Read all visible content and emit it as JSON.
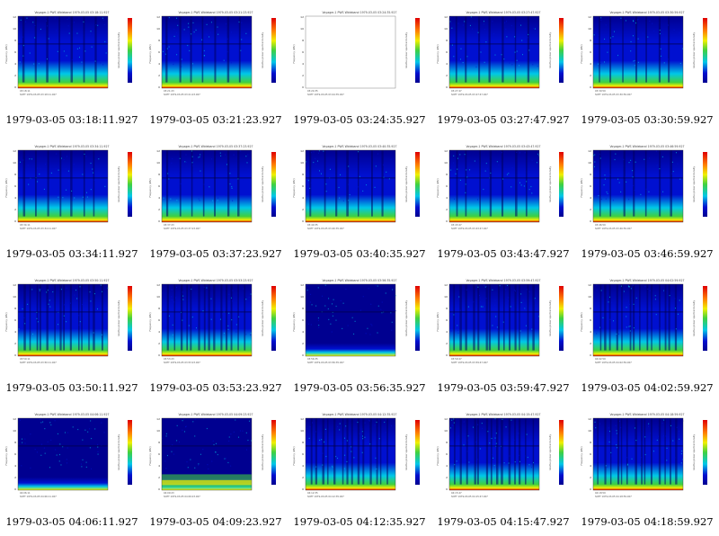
{
  "panel_title_prefix": "Voyager-1 PWS Wideband",
  "axes": {
    "ylabel": "Frequency (kHz)",
    "cbar_label": "relative power spectral density",
    "yticks": [
      "12",
      "10",
      "8",
      "6",
      "4",
      "2",
      "0"
    ],
    "scet_label": "SCET"
  },
  "colors": {
    "deep_blue": "#000090",
    "blue": "#0010d0",
    "cyan": "#00c8e8",
    "green": "#40d040",
    "yellow": "#f0f000",
    "orange": "#ff8000",
    "red": "#e00000"
  },
  "panels": [
    {
      "caption": "1979-03-05 03:18:11.927",
      "title_id": "1979-03-05 03:18:11.927",
      "variant": "striped"
    },
    {
      "caption": "1979-03-05 03:21:23.927",
      "title_id": "1979-03-05 03:21:23.927",
      "variant": "striped"
    },
    {
      "caption": "1979-03-05 03:24:35.927",
      "title_id": "1979-03-05 03:24:35.927",
      "variant": "empty"
    },
    {
      "caption": "1979-03-05 03:27:47.927",
      "title_id": "1979-03-05 03:27:47.927",
      "variant": "striped"
    },
    {
      "caption": "1979-03-05 03:30:59.927",
      "title_id": "1979-03-05 03:30:59.927",
      "variant": "striped"
    },
    {
      "caption": "1979-03-05 03:34:11.927",
      "title_id": "1979-03-05 03:34:11.927",
      "variant": "striped"
    },
    {
      "caption": "1979-03-05 03:37:23.927",
      "title_id": "1979-03-05 03:37:23.927",
      "variant": "striped"
    },
    {
      "caption": "1979-03-05 03:40:35.927",
      "title_id": "1979-03-05 03:40:35.927",
      "variant": "striped"
    },
    {
      "caption": "1979-03-05 03:43:47.927",
      "title_id": "1979-03-05 03:43:47.927",
      "variant": "striped"
    },
    {
      "caption": "1979-03-05 03:46:59.927",
      "title_id": "1979-03-05 03:46:59.927",
      "variant": "striped"
    },
    {
      "caption": "1979-03-05 03:50:11.927",
      "title_id": "1979-03-05 03:50:11.927",
      "variant": "banded"
    },
    {
      "caption": "1979-03-05 03:53:23.927",
      "title_id": "1979-03-05 03:53:23.927",
      "variant": "banded"
    },
    {
      "caption": "1979-03-05 03:56:35.927",
      "title_id": "1979-03-05 03:56:35.927",
      "variant": "dark"
    },
    {
      "caption": "1979-03-05 03:59:47.927",
      "title_id": "1979-03-05 03:59:47.927",
      "variant": "banded"
    },
    {
      "caption": "1979-03-05 04:02:59.927",
      "title_id": "1979-03-05 04:02:59.927",
      "variant": "banded"
    },
    {
      "caption": "1979-03-05 04:06:11.927",
      "title_id": "1979-03-05 04:06:11.927",
      "variant": "dark"
    },
    {
      "caption": "1979-03-05 04:09:23.927",
      "title_id": "1979-03-05 04:09:23.927",
      "variant": "noisy"
    },
    {
      "caption": "1979-03-05 04:12:35.927",
      "title_id": "1979-03-05 04:12:35.927",
      "variant": "banded"
    },
    {
      "caption": "1979-03-05 04:15:47.927",
      "title_id": "1979-03-05 04:15:47.927",
      "variant": "banded"
    },
    {
      "caption": "1979-03-05 04:18:59.927",
      "title_id": "1979-03-05 04:18:59.927",
      "variant": "banded"
    }
  ]
}
